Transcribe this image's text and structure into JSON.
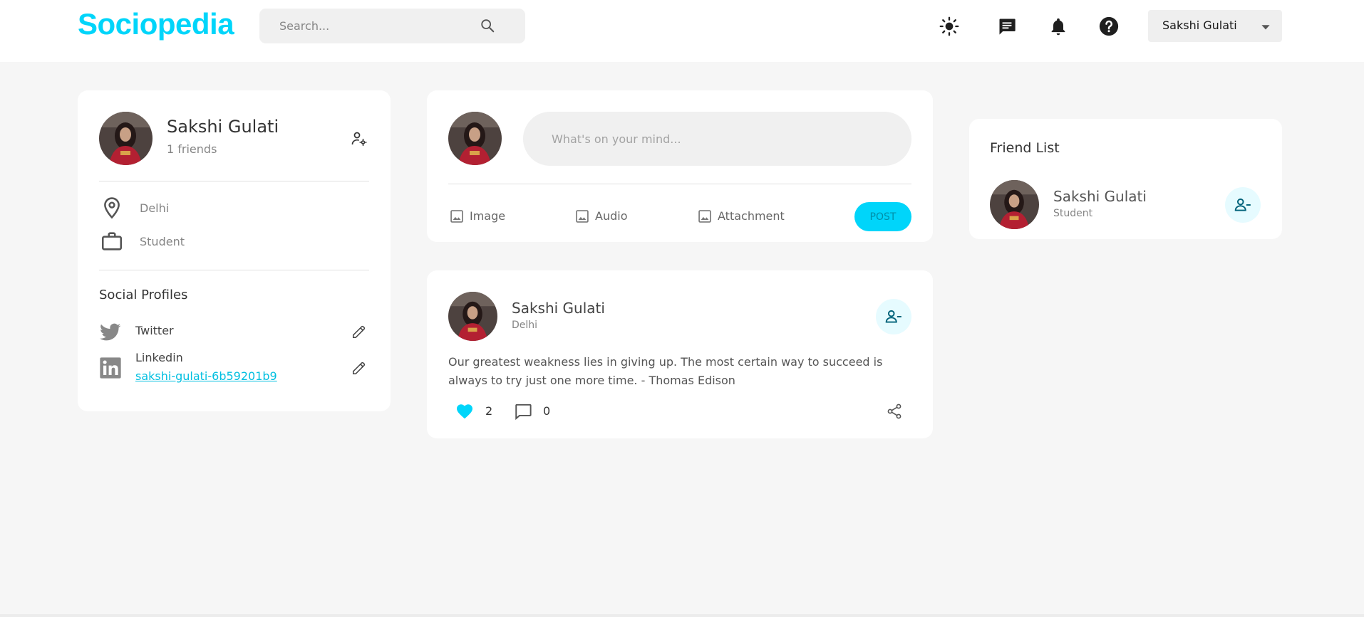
{
  "brand": {
    "logo": "Sociopedia",
    "accent_color": "#00d5fa"
  },
  "search": {
    "placeholder": "Search...",
    "icon": "search-icon"
  },
  "nav": {
    "icons": [
      "dark-mode-icon",
      "message-icon",
      "notification-icon",
      "help-icon"
    ],
    "user_select": {
      "value": "Sakshi Gulati"
    }
  },
  "profile_card": {
    "name": "Sakshi Gulati",
    "friends": "1 friends",
    "location": "Delhi",
    "occupation": "Student",
    "social_title": "Social Profiles",
    "socials": [
      {
        "network": "Twitter",
        "handle": ""
      },
      {
        "network": "Linkedin",
        "handle": "sakshi-gulati-6b59201b9"
      }
    ]
  },
  "composer": {
    "placeholder": "What's on your mind...",
    "options": [
      "Image",
      "Audio",
      "Attachment"
    ],
    "post_label": "POST"
  },
  "feed": [
    {
      "author": "Sakshi Gulati",
      "location": "Delhi",
      "body_line1": "Our greatest weakness lies in giving up. The most certain way to succeed is",
      "body_line2": "always to try just one more time. - Thomas Edison",
      "likes": "2",
      "comments": "0",
      "liked": true
    }
  ],
  "friend_list": {
    "title": "Friend List",
    "friends": [
      {
        "name": "Sakshi Gulati",
        "subtitle": "Student"
      }
    ]
  }
}
